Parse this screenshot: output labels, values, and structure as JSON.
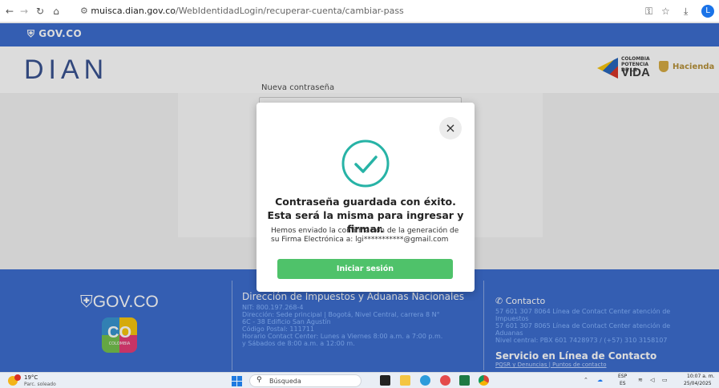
{
  "browser": {
    "url_site": "muisca.dian.gov.co",
    "url_path": "/WebIdentidadLogin/recuperar-cuenta/cambiar-pass",
    "profile_initial": "L"
  },
  "govbar": {
    "logo": "GOV.CO"
  },
  "header": {
    "dian_logo": "DIAN",
    "colombia_small": "COLOMBIA POTENCIA DE LA",
    "colombia_vida": "VIDA",
    "hacienda": "Hacienda"
  },
  "form": {
    "password_label": "Nueva contraseña"
  },
  "modal": {
    "title": "Contraseña guardada con éxito. Esta será la misma para ingresar y firmar.",
    "message": "Hemos enviado la confirmación de la generación de su Firma Electrónica a: lgi***********@gmail.com",
    "button": "Iniciar sesión",
    "close": "×"
  },
  "footer": {
    "gov_logo": "GOV.CO",
    "co_logo": "CO",
    "co_sub": "COLOMBIA",
    "dir_title": "Dirección de Impuestos y Aduanas Nacionales",
    "dir_lines": [
      "NIT: 800.197.268-4",
      "Dirección: Sede principal | Bogotá, Nivel Central, carrera 8 N°",
      "6C - 38 Edificio San Agustín",
      "Código Postal: 111711",
      "Horario Contact Center: Lunes a Viernes 8:00 a.m. a 7:00 p.m.",
      "y Sábados de 8:00 a.m. a 12:00 m."
    ],
    "contact_title": "Contacto",
    "contact_lines": [
      "57 601 307 8064 Línea de Contact Center atención de",
      "Impuestos",
      "57 601 307 8065 Línea de Contact Center atención de",
      "Aduanas",
      "Nivel central: PBX 601 7428973 / (+57) 310 3158107"
    ],
    "servicio": "Servicio en Línea de Contacto",
    "pqsr": "PQSR y Denuncias | Puntos de contacto"
  },
  "taskbar": {
    "temp": "19°C",
    "weather": "Parc. soleado",
    "search_placeholder": "Búsqueda",
    "lang1": "ESP",
    "lang2": "ES",
    "time": "10:07 a. m.",
    "date": "25/04/2025"
  }
}
